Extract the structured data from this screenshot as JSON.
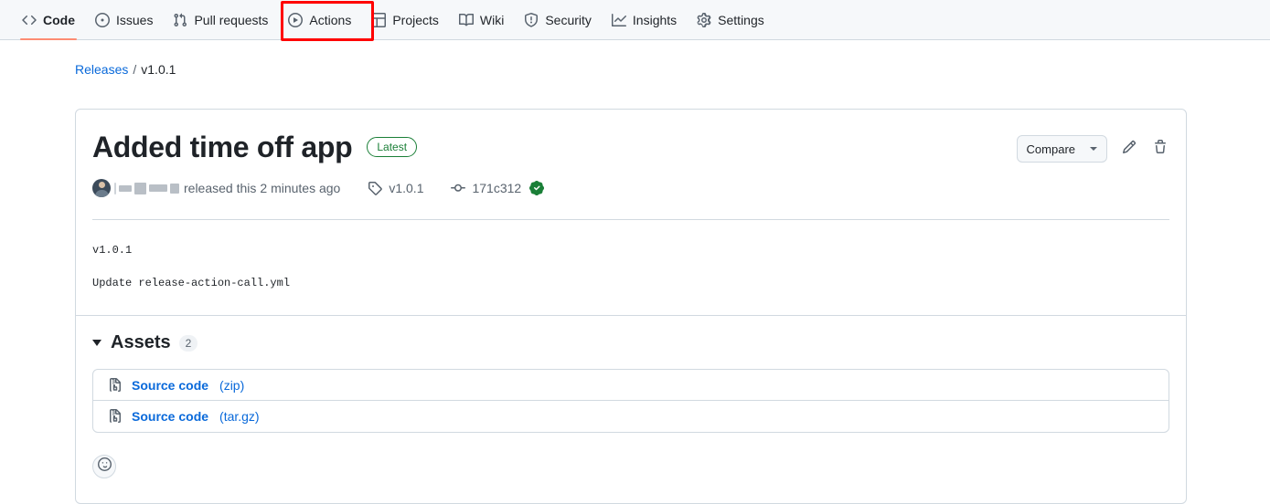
{
  "nav": {
    "items": [
      {
        "label": "Code",
        "icon": "code-icon",
        "active": true
      },
      {
        "label": "Issues",
        "icon": "issue-opened-icon",
        "active": false
      },
      {
        "label": "Pull requests",
        "icon": "git-pull-request-icon",
        "active": false
      },
      {
        "label": "Actions",
        "icon": "play-circle-icon",
        "active": false
      },
      {
        "label": "Projects",
        "icon": "table-icon",
        "active": false
      },
      {
        "label": "Wiki",
        "icon": "book-icon",
        "active": false
      },
      {
        "label": "Security",
        "icon": "shield-icon",
        "active": false
      },
      {
        "label": "Insights",
        "icon": "graph-icon",
        "active": false
      },
      {
        "label": "Settings",
        "icon": "gear-icon",
        "active": false
      }
    ],
    "active_underline_color": "#fd8c73",
    "annotation": {
      "target": "Actions",
      "color": "#ff0000"
    }
  },
  "breadcrumb": {
    "parent": "Releases",
    "separator": "/",
    "current": "v1.0.1"
  },
  "release": {
    "title": "Added time off app",
    "badge": "Latest",
    "badge_color": "#1a7f37",
    "author_redacted": true,
    "released_text": "released this",
    "time_ago": "2 minutes ago",
    "tag": "v1.0.1",
    "commit": "171c312",
    "verified": true,
    "body_lines": [
      "v1.0.1",
      "Update release-action-call.yml"
    ]
  },
  "toolbar": {
    "compare_label": "Compare",
    "edit_icon": "pencil-icon",
    "delete_icon": "trash-icon"
  },
  "assets": {
    "title": "Assets",
    "count": "2",
    "expanded": true,
    "items": [
      {
        "name": "Source code",
        "ext": "(zip)"
      },
      {
        "name": "Source code",
        "ext": "(tar.gz)"
      }
    ]
  },
  "reactions": {
    "add_label": "smiley-icon"
  }
}
